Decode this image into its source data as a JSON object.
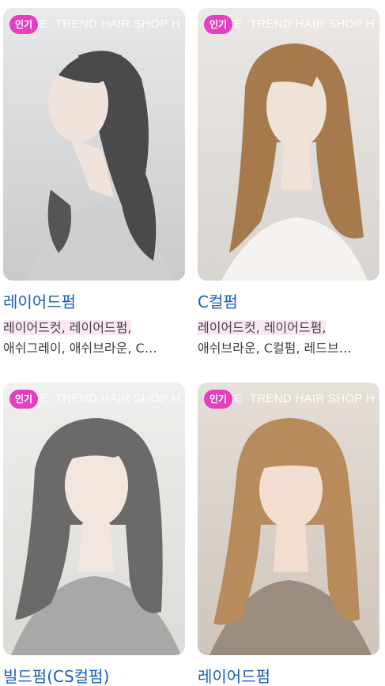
{
  "banner_text": "TREND HAIR SHOP H",
  "banner_prefix": "SE",
  "badge_label": "인기",
  "colors": {
    "badge": "#e33fbe",
    "title": "#1a5fb4",
    "highlight": "#fce8f4"
  },
  "cards": [
    {
      "title": "레이어드펌",
      "desc_highlight": "레이어드컷, 레이어드펌,",
      "desc_rest": " 애쉬그레이, 애쉬브라운, C…",
      "hair_color": "#4a4a4c",
      "bg_color": "#d9dadc",
      "skin": "#efe3dc",
      "shirt": "#cfcfcf"
    },
    {
      "title": "C컬펌",
      "desc_highlight": "레이어드컷, 레이어드펌,",
      "desc_rest": " 애쉬브라운, C컬펌, 레드브…",
      "hair_color": "#a77a4d",
      "bg_color": "#e3e0dd",
      "skin": "#f1e2d8",
      "shirt": "#f5f2ef"
    },
    {
      "title": "빌드펌(CS컬펌)",
      "desc_highlight": "",
      "desc_rest": "",
      "hair_color": "#6c6a69",
      "bg_color": "#e6e5e3",
      "skin": "#f3e6de",
      "shirt": "#a9a8a6"
    },
    {
      "title": "레이어드펌",
      "desc_highlight": "",
      "desc_rest": "",
      "hair_color": "#b88b5c",
      "bg_color": "#ddd6cf",
      "skin": "#f2ddd0",
      "shirt": "#9a8d7f"
    }
  ]
}
